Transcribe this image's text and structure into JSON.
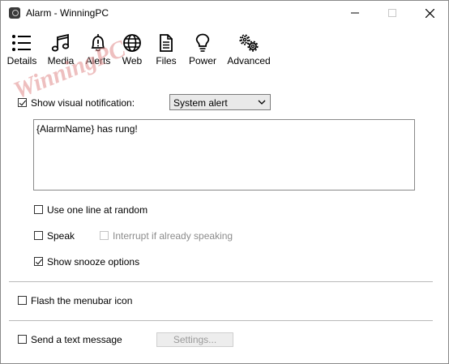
{
  "window": {
    "title": "Alarm - WinningPC"
  },
  "titlebar": {
    "minimize_icon": "minimize-icon",
    "maximize_icon": "maximize-icon",
    "close_icon": "close-icon"
  },
  "toolbar": {
    "items": [
      {
        "label": "Details",
        "icon": "list-icon"
      },
      {
        "label": "Media",
        "icon": "music-note-icon"
      },
      {
        "label": "Alerts",
        "icon": "bell-alert-icon"
      },
      {
        "label": "Web",
        "icon": "globe-icon"
      },
      {
        "label": "Files",
        "icon": "file-icon"
      },
      {
        "label": "Power",
        "icon": "lightbulb-icon"
      },
      {
        "label": "Advanced",
        "icon": "gears-icon"
      }
    ]
  },
  "watermark": {
    "text": "WinningPC"
  },
  "visual_notification": {
    "label": "Show visual notification:",
    "checked": true,
    "select_value": "System alert",
    "message": "{AlarmName} has rung!"
  },
  "options": {
    "one_line_random": {
      "label": "Use one line at random",
      "checked": false
    },
    "speak": {
      "label": "Speak",
      "checked": false
    },
    "interrupt": {
      "label": "Interrupt if already speaking",
      "checked": false,
      "disabled": true
    },
    "snooze": {
      "label": "Show snooze options",
      "checked": true
    }
  },
  "flash_menubar": {
    "label": "Flash the menubar icon",
    "checked": false
  },
  "text_message": {
    "label": "Send a text message",
    "checked": false,
    "settings_button": "Settings..."
  },
  "colors": {
    "border": "#8a8a8a",
    "separator": "#b9b9b9",
    "disabled_text": "#8c8c8c"
  }
}
